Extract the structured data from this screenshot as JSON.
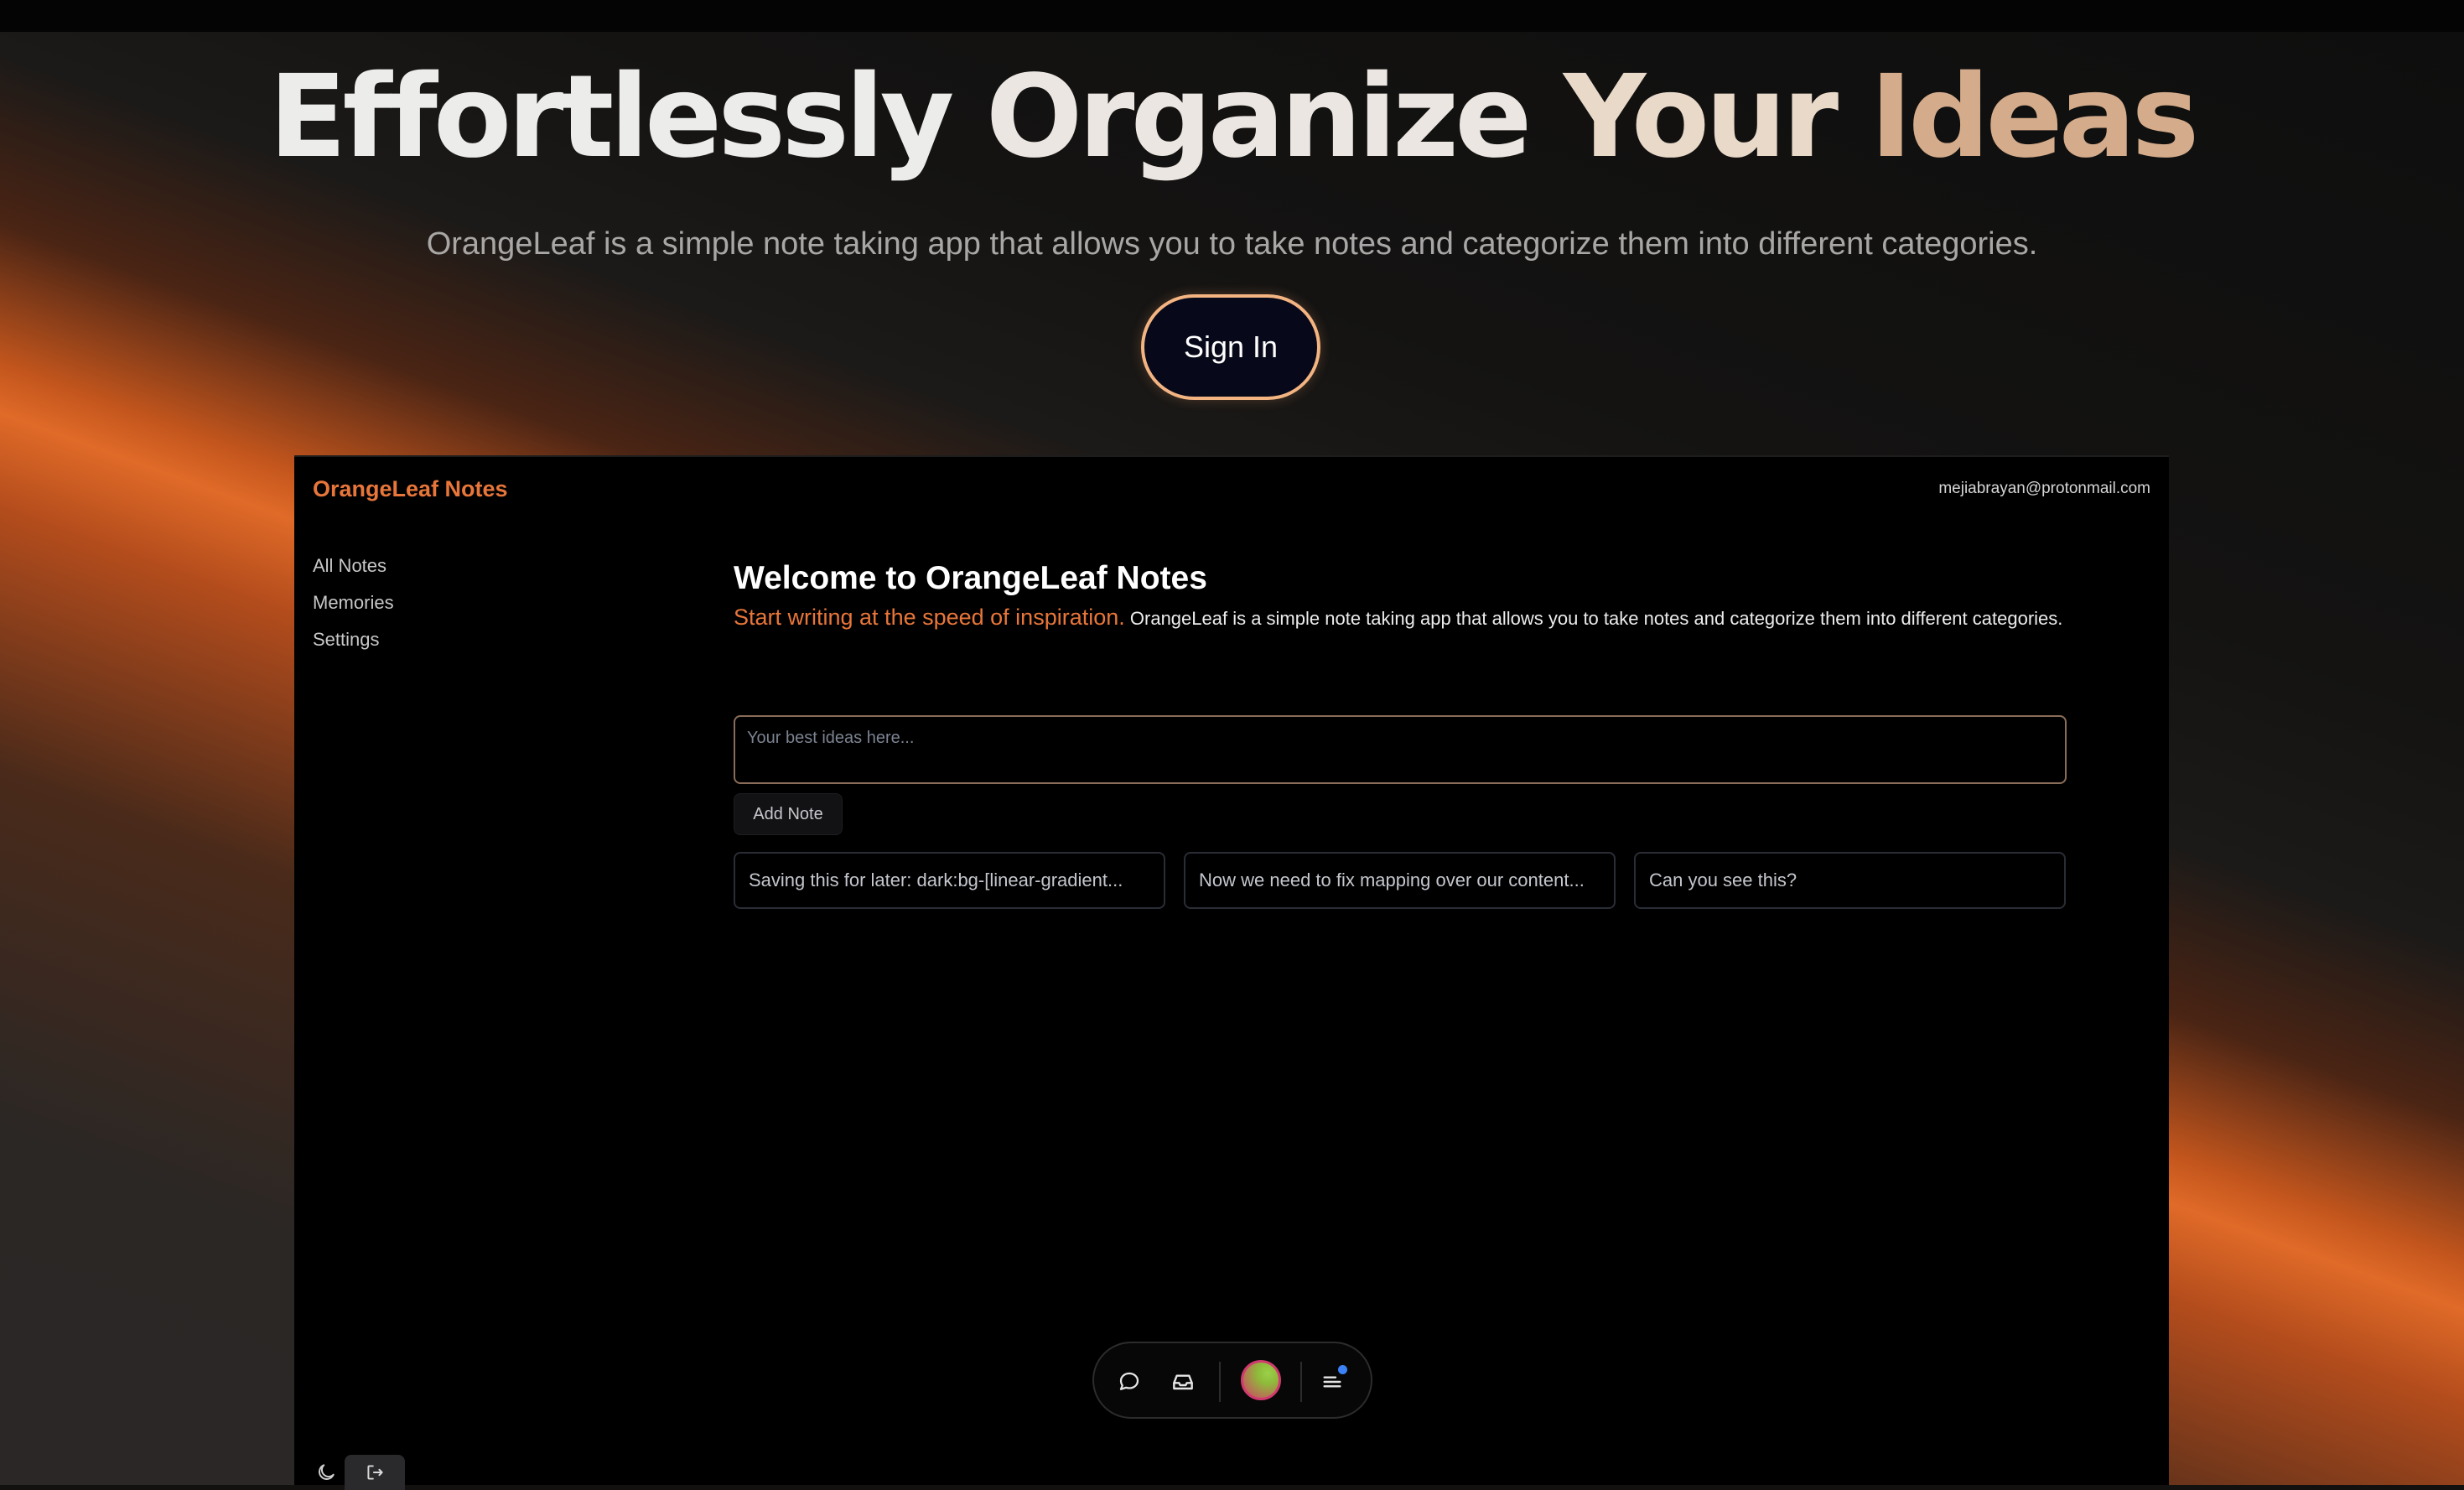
{
  "hero": {
    "title_words": [
      "Effortlessly",
      "Organize",
      "Your",
      "Ideas"
    ],
    "subtitle": "OrangeLeaf is a simple note taking app that allows you to take notes and categorize them into different categories.",
    "signin_label": "Sign In"
  },
  "app": {
    "brand": "OrangeLeaf Notes",
    "user_email": "mejiabrayan@protonmail.com",
    "sidebar": {
      "items": [
        {
          "label": "All Notes"
        },
        {
          "label": "Memories"
        },
        {
          "label": "Settings"
        }
      ]
    },
    "main": {
      "welcome_title": "Welcome to OrangeLeaf Notes",
      "tagline": "Start writing at the speed of inspiration.",
      "description": "OrangeLeaf is a simple note taking app that allows you to take notes and categorize them into different categories.",
      "note_input": {
        "value": "",
        "placeholder": "Your best ideas here..."
      },
      "add_note_label": "Add Note",
      "notes": [
        {
          "text": "Saving this for later: dark:bg-[linear-gradient..."
        },
        {
          "text": "Now we need to fix mapping over our content..."
        },
        {
          "text": "Can you see this?"
        }
      ]
    },
    "dock": {
      "icons": [
        "chat-icon",
        "inbox-icon",
        "avatar",
        "menu-icon"
      ],
      "menu_has_notification": true
    },
    "footer_icons": [
      "moon-icon",
      "logout-icon"
    ]
  },
  "colors": {
    "accent": "#e8763a",
    "signin_border": "#f3b482",
    "notification": "#3b82f6"
  }
}
